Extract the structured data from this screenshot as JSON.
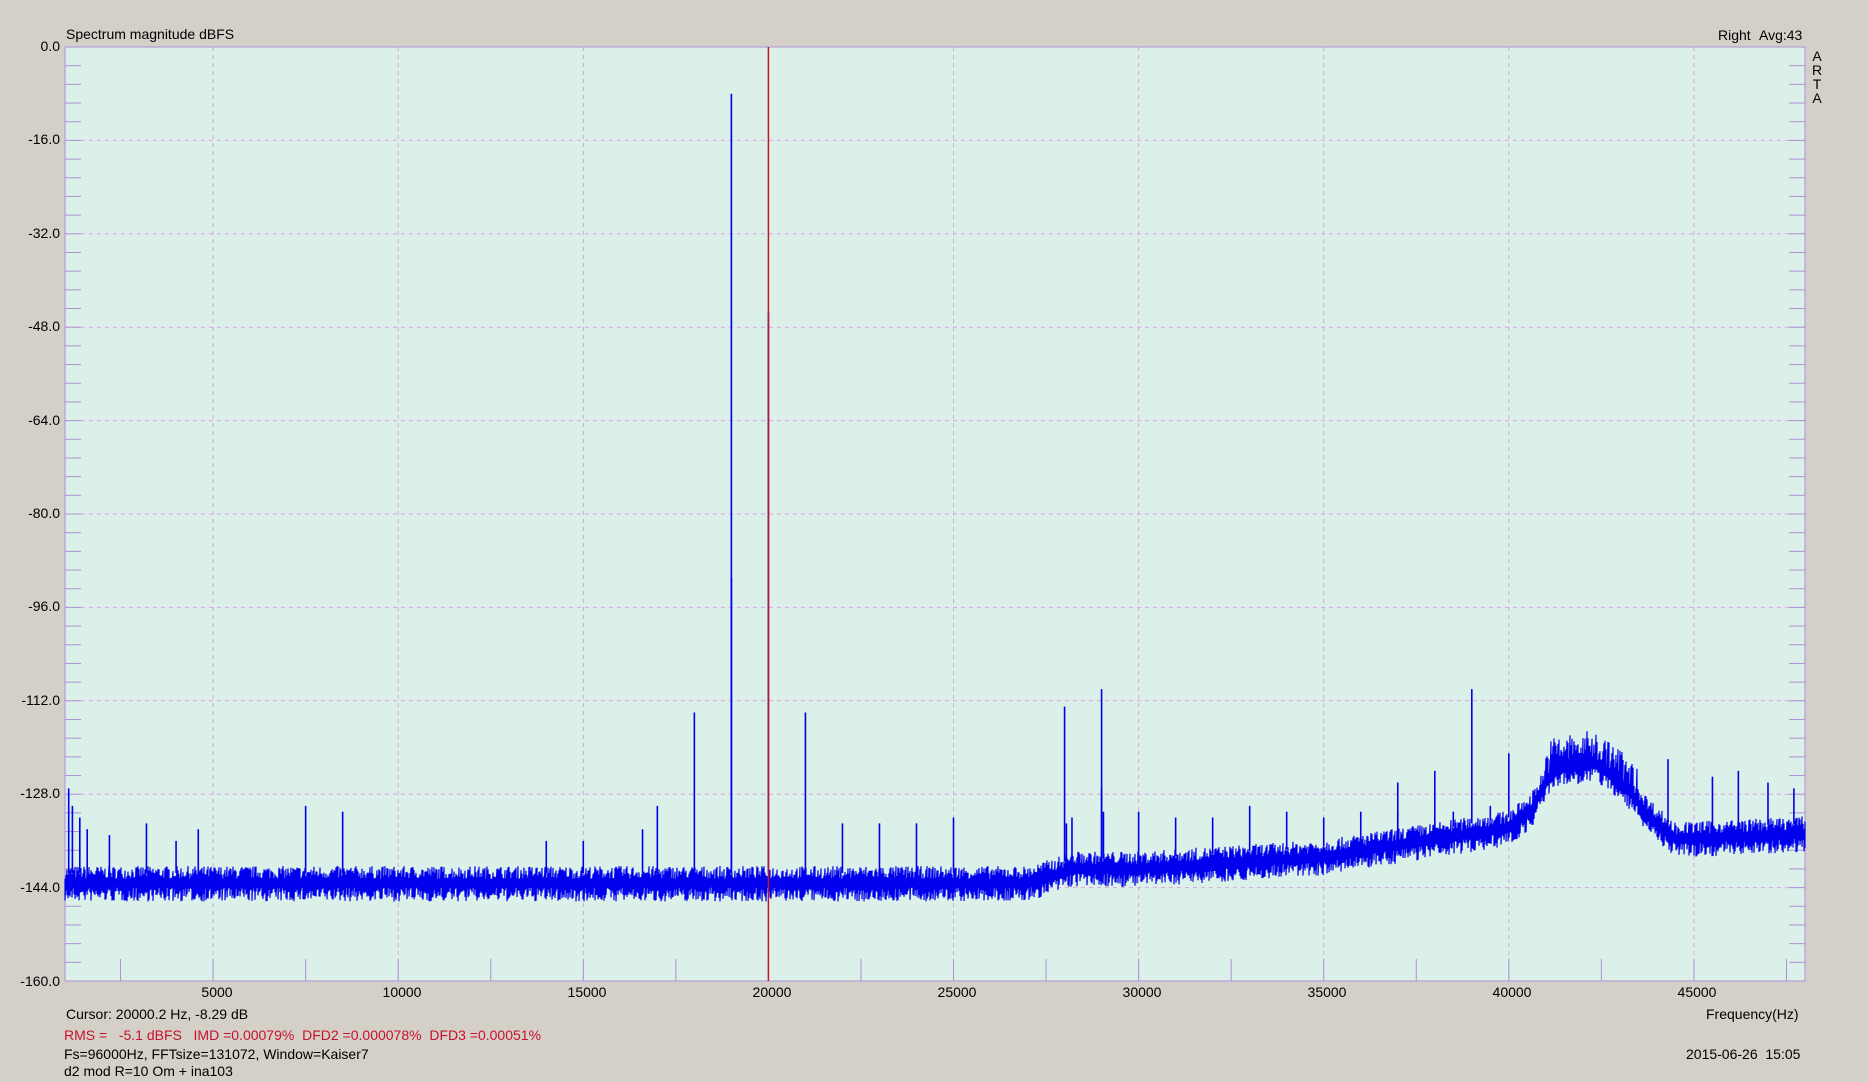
{
  "chart_data": {
    "type": "line",
    "title": "Spectrum magnitude dBFS",
    "channel": "Right",
    "avg": "Avg:43",
    "xlabel": "Frequency(Hz)",
    "ylabel": "",
    "xlim": [
      1000,
      48000
    ],
    "ylim": [
      -160,
      0
    ],
    "x_ticks": [
      "5000",
      "10000",
      "15000",
      "20000",
      "25000",
      "30000",
      "35000",
      "40000",
      "45000"
    ],
    "y_ticks": [
      "0.0",
      "-16.0",
      "-32.0",
      "-48.0",
      "-64.0",
      "-80.0",
      "-96.0",
      "-112.0",
      "-128.0",
      "-144.0",
      "-160.0"
    ],
    "grid": true,
    "cursor": {
      "x": 20000.2,
      "y": -8.29
    },
    "series": [
      {
        "color": "#0000ee",
        "noise_floor": [
          [
            1000,
            -143.5
          ],
          [
            27000,
            -143.5
          ],
          [
            27800,
            -142
          ],
          [
            28200,
            -141
          ],
          [
            30000,
            -141
          ],
          [
            35000,
            -139
          ],
          [
            38000,
            -136
          ],
          [
            40000,
            -134
          ],
          [
            40600,
            -131
          ],
          [
            41200,
            -124
          ],
          [
            42300,
            -123
          ],
          [
            43000,
            -126
          ],
          [
            43800,
            -132
          ],
          [
            44500,
            -136
          ],
          [
            48000,
            -135
          ]
        ],
        "peaks": [
          [
            1100,
            -127
          ],
          [
            1200,
            -130
          ],
          [
            1400,
            -132
          ],
          [
            1600,
            -134
          ],
          [
            2200,
            -135
          ],
          [
            3200,
            -133
          ],
          [
            4000,
            -136
          ],
          [
            4600,
            -134
          ],
          [
            7500,
            -130
          ],
          [
            8500,
            -131
          ],
          [
            14000,
            -136
          ],
          [
            15000,
            -136
          ],
          [
            16600,
            -134
          ],
          [
            17000,
            -130
          ],
          [
            18000,
            -114
          ],
          [
            19000,
            -8
          ],
          [
            19000,
            -91
          ],
          [
            20000,
            -45.5
          ],
          [
            21000,
            -114
          ],
          [
            22000,
            -133
          ],
          [
            23000,
            -133
          ],
          [
            24000,
            -133
          ],
          [
            25000,
            -132
          ],
          [
            28000,
            -113
          ],
          [
            28050,
            -133
          ],
          [
            28200,
            -132
          ],
          [
            29000,
            -110
          ],
          [
            29000,
            -127
          ],
          [
            29050,
            -131
          ],
          [
            30000,
            -131
          ],
          [
            31000,
            -132
          ],
          [
            32000,
            -132
          ],
          [
            33000,
            -130
          ],
          [
            34000,
            -131
          ],
          [
            35000,
            -132
          ],
          [
            36000,
            -131
          ],
          [
            37000,
            -126
          ],
          [
            37000,
            -131
          ],
          [
            38000,
            -124
          ],
          [
            38500,
            -131
          ],
          [
            39000,
            -110
          ],
          [
            39000,
            -133
          ],
          [
            39500,
            -130
          ],
          [
            40000,
            -121
          ],
          [
            44300,
            -122
          ],
          [
            45500,
            -125
          ],
          [
            46200,
            -124
          ],
          [
            47000,
            -126
          ],
          [
            47700,
            -127
          ]
        ]
      }
    ]
  },
  "labels": {
    "cursor": "Cursor: 20000.2 Hz, -8.29 dB",
    "measurements": "RMS =   -5.1 dBFS   IMD =0.00079%  DFD2 =0.000078%  DFD3 =0.00051%",
    "settings": "Fs=96000Hz, FFTsize=131072, Window=Kaiser7",
    "comment": "d2 mod R=10 Om + ina103",
    "timestamp": "2015-06-26  15:05",
    "logo": [
      "A",
      "R",
      "T",
      "A"
    ]
  },
  "colors": {
    "plot_bg": "#daf0e8",
    "grid": "#e0a0e0",
    "trace": "#0000ee",
    "cursor": "#c8102e",
    "frame": "#b090d8"
  }
}
